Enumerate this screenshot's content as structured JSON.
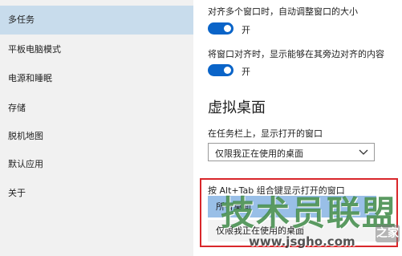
{
  "sidebar": {
    "items": [
      {
        "label": "多任务",
        "active": true
      },
      {
        "label": "平板电脑模式"
      },
      {
        "label": "电源和睡眠"
      },
      {
        "label": "存储"
      },
      {
        "label": "脱机地图"
      },
      {
        "label": "默认应用"
      },
      {
        "label": "关于"
      }
    ]
  },
  "snap": {
    "setting1_text": "对齐多个窗口时，自动调整窗口的大小",
    "setting1_state": "开",
    "setting2_text": "将窗口对齐时，显示能够在其旁边对齐的内容",
    "setting2_state": "开"
  },
  "virtual_desktops": {
    "title": "虚拟桌面",
    "taskbar_label": "在任务栏上，显示打开的窗口",
    "taskbar_value": "仅限我正在使用的桌面",
    "alt_tab_label": "按 Alt+Tab 组合键显示打开的窗口",
    "options": [
      "所有桌面",
      "仅限我正在使用的桌面"
    ]
  },
  "watermark": {
    "title": "技术员联盟",
    "url": "www.jsgho.com",
    "tag": "之家"
  },
  "colors": {
    "sidebar_bg": "#f1f1f1",
    "active_item": "#c8dcec",
    "toggle_on": "#0a64c8",
    "highlight_border": "#d9272b",
    "selected_option": "#99bfe7"
  }
}
